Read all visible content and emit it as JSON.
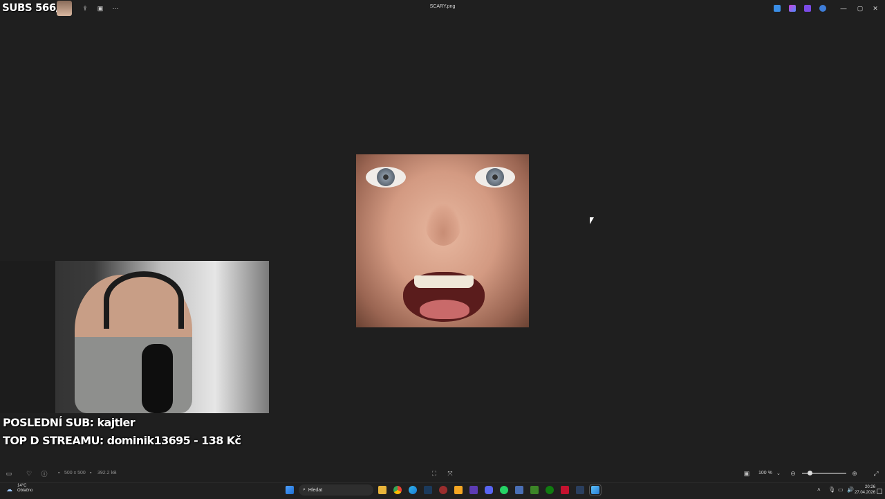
{
  "window": {
    "title": "SCARY.png"
  },
  "overlay": {
    "subs_text": "SUBS 566/",
    "last_sub": "POSLEDNÍ SUB: kajtler",
    "top_donor": "TOP D STREAMU: dominik13695 - 138 Kč"
  },
  "statusbar": {
    "dimensions": "500 x 500",
    "file_size": "392.2 kB",
    "zoom": "100 %"
  },
  "taskbar": {
    "weather_temp": "14°C",
    "weather_desc": "Oblačno",
    "search_placeholder": "Hledat",
    "time": "20:26",
    "date": "27.04.2026"
  },
  "colors": {
    "background": "#1f1f1f",
    "taskbar": "#202020",
    "accent": "#4ea0ff"
  }
}
